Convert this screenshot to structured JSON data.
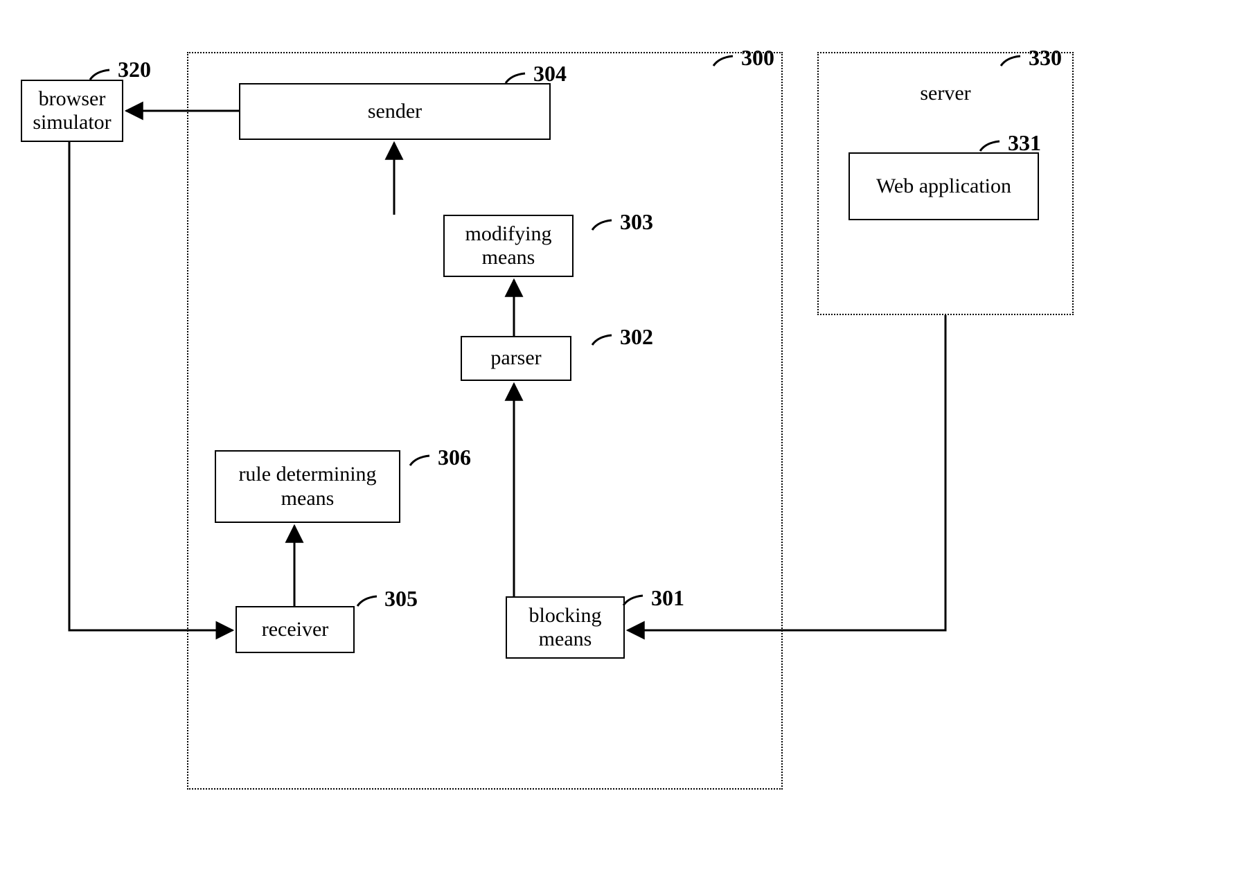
{
  "blocks": {
    "browser_simulator": {
      "label": "browser\nsimulator",
      "ref": "320"
    },
    "sender": {
      "label": "sender",
      "ref": "304"
    },
    "modifying_means": {
      "label": "modifying\nmeans",
      "ref": "303"
    },
    "parser": {
      "label": "parser",
      "ref": "302"
    },
    "rule_determining": {
      "label": "rule determining\nmeans",
      "ref": "306"
    },
    "receiver": {
      "label": "receiver",
      "ref": "305"
    },
    "blocking_means": {
      "label": "blocking\nmeans",
      "ref": "301"
    },
    "server": {
      "label": "server",
      "ref": "330"
    },
    "web_application": {
      "label": "Web application",
      "ref": "331"
    },
    "container": {
      "ref": "300"
    }
  }
}
